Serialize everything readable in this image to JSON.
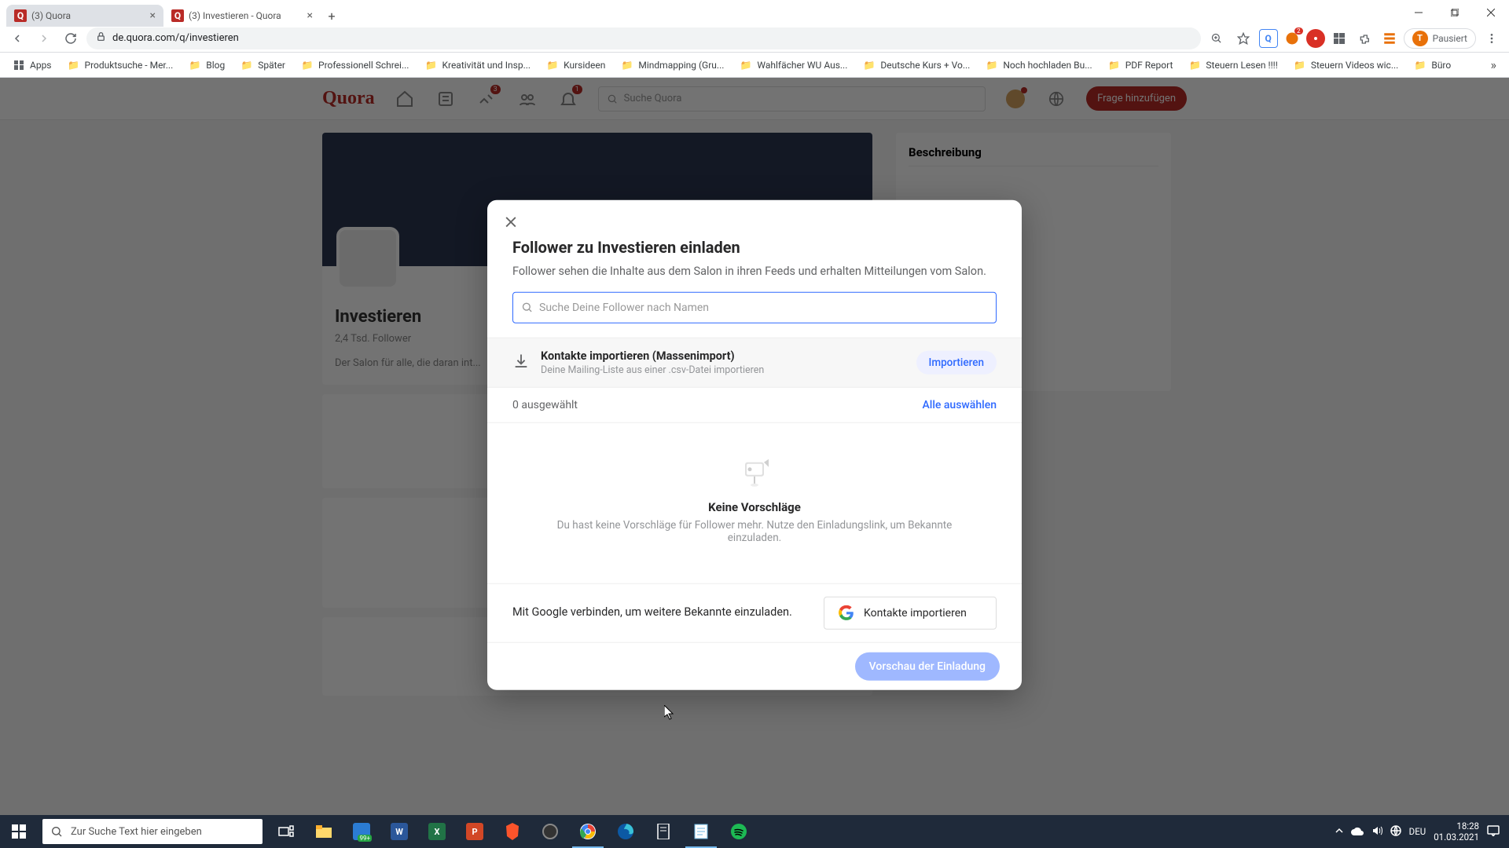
{
  "window": {
    "minimize": "—",
    "maximize": "☐",
    "close": "✕"
  },
  "tabs": [
    {
      "title": "(3) Quora"
    },
    {
      "title": "(3) Investieren - Quora"
    }
  ],
  "address": "de.quora.com/q/investieren",
  "profile_label": "Pausiert",
  "profile_initial": "T",
  "bookmarks": [
    {
      "icon": "apps",
      "label": "Apps"
    },
    {
      "icon": "folder",
      "label": "Produktsuche - Mer..."
    },
    {
      "icon": "folder",
      "label": "Blog"
    },
    {
      "icon": "folder",
      "label": "Später"
    },
    {
      "icon": "folder",
      "label": "Professionell Schrei..."
    },
    {
      "icon": "folder",
      "label": "Kreativität und Insp..."
    },
    {
      "icon": "folder",
      "label": "Kursideen"
    },
    {
      "icon": "folder",
      "label": "Mindmapping  (Gru..."
    },
    {
      "icon": "folder",
      "label": "Wahlfächer WU Aus..."
    },
    {
      "icon": "folder",
      "label": "Deutsche Kurs + Vo..."
    },
    {
      "icon": "folder",
      "label": "Noch hochladen Bu..."
    },
    {
      "icon": "folder",
      "label": "PDF Report"
    },
    {
      "icon": "folder",
      "label": "Steuern Lesen !!!!"
    },
    {
      "icon": "folder",
      "label": "Steuern Videos wic..."
    },
    {
      "icon": "folder",
      "label": "Büro"
    }
  ],
  "quora": {
    "logo": "Quora",
    "search_placeholder": "Suche Quora",
    "add_button": "Frage hinzufügen",
    "notif_badge1": "3",
    "notif_badge2": "1",
    "space_title": "Investieren",
    "space_sub": "2,4 Tsd. Follower",
    "space_desc": "Der Salon für alle, die daran int..."
  },
  "sidebar_heading": "Beschreibung",
  "modal": {
    "title": "Follower zu Investieren einladen",
    "desc": "Follower sehen die Inhalte aus dem Salon in ihren Feeds und erhalten Mitteilungen vom Salon.",
    "search_placeholder": "Suche Deine Follower nach Namen",
    "import_title": "Kontakte importieren (Massenimport)",
    "import_sub": "Deine Mailing-Liste aus einer .csv-Datei importieren",
    "import_btn": "Importieren",
    "selected": "0 ausgewählt",
    "select_all": "Alle auswählen",
    "empty_title": "Keine Vorschläge",
    "empty_desc": "Du hast keine Vorschläge für Follower mehr. Nutze den Einladungslink, um Bekannte einzuladen.",
    "google_text": "Mit Google verbinden, um weitere Bekannte einzuladen.",
    "google_btn": "Kontakte importieren",
    "preview_btn": "Vorschau der Einladung"
  },
  "taskbar": {
    "search_placeholder": "Zur Suche Text hier eingeben",
    "lang": "DEU",
    "time": "18:28",
    "date": "01.03.2021",
    "badge": "99+"
  }
}
